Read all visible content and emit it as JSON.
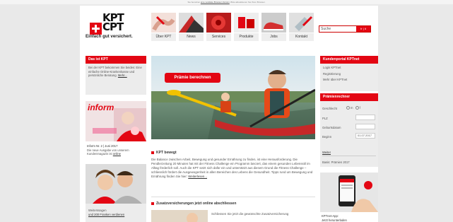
{
  "topline": {
    "prefix": "Sie benutzen",
    "link": "eine veraltete Browser-Version",
    "suffix": ". Bitte aktualisieren Sie Ihren Browser."
  },
  "logo": {
    "line1": "KPT",
    "line2": "CPT",
    "tagline": "Einfach gut versichert."
  },
  "nav": [
    {
      "label": "Über KPT",
      "icon": "hands-image-icon"
    },
    {
      "label": "News",
      "icon": "news-image-icon"
    },
    {
      "label": "Services",
      "icon": "flower-image-icon"
    },
    {
      "label": "Produkte",
      "icon": "products-image-icon"
    },
    {
      "label": "Jobs",
      "icon": "shoes-image-icon"
    },
    {
      "label": "Kontakt",
      "icon": "contact-image-icon"
    }
  ],
  "search": {
    "placeholder": "Suche",
    "button": "fr | it"
  },
  "left": {
    "about": {
      "title": "Das ist KPT",
      "text": "Bei der KPT bekommen Sie beides: Eine einfache Online-Krankenkasse und persönliche Beratung.",
      "link": "Mehr..."
    },
    "inform": {
      "title": "inform",
      "issue": "Inform Nr. 2 | Juni 2017",
      "text": "Die neue Ausgabe von unserem Kundenmagazin ist",
      "link": "online"
    },
    "promo": {
      "text": "Weiterssagen",
      "link": "und 200 Franken verdienen"
    }
  },
  "hero": {
    "button": "Prämie berechnen"
  },
  "article": {
    "title": "KPT bewegt",
    "text": "Die Balance zwischen Arbeit, Bewegung und gesunder Ernährung zu finden, ist eine Herausforderung. Die Pendlerzeitung 20 Minuten hat mit der Fitness Challenge ein Programm lanciert, das einem gesunden Lebensstil im Alltag förderlich soll. Auch die KPT setzt sich dafür ein und unterstützt aus diesem Grund die Fitness Challenge – schliesslich fördert die Ausgewogenheit in allen Bereichen des Lebens die Gesundheit. Tipps rund um Bewegung und Ernährung finden Sie hier:",
    "link": "Weiterlesen..."
  },
  "article2": {
    "title": "Zusatzversicherungen jetzt online abschliessen",
    "text": "Schliessen Sie jetzt die gewünschte Zusatzversicherung"
  },
  "right": {
    "portal": {
      "title": "Kundenportal KPTnet",
      "items": [
        "Login KPTnet",
        "Registrierung",
        "Mehr über KPTnet"
      ]
    },
    "calc": {
      "title": "Prämienrechner",
      "gender_label": "Geschlecht",
      "gender_m": "m",
      "gender_f": "f",
      "plz_label": "PLZ",
      "birth_label": "Geburtsdatum",
      "start_label": "Beginn",
      "start_value": "01.07.2017",
      "next": "Weiter",
      "basis": "Basis: Prämien 2017"
    },
    "app": {
      "title": "KPTnet-App:",
      "link": "Jetzt herunterladen"
    }
  },
  "colors": {
    "accent": "#e30613",
    "box": "#ececec",
    "background": "#e9e9e9"
  }
}
